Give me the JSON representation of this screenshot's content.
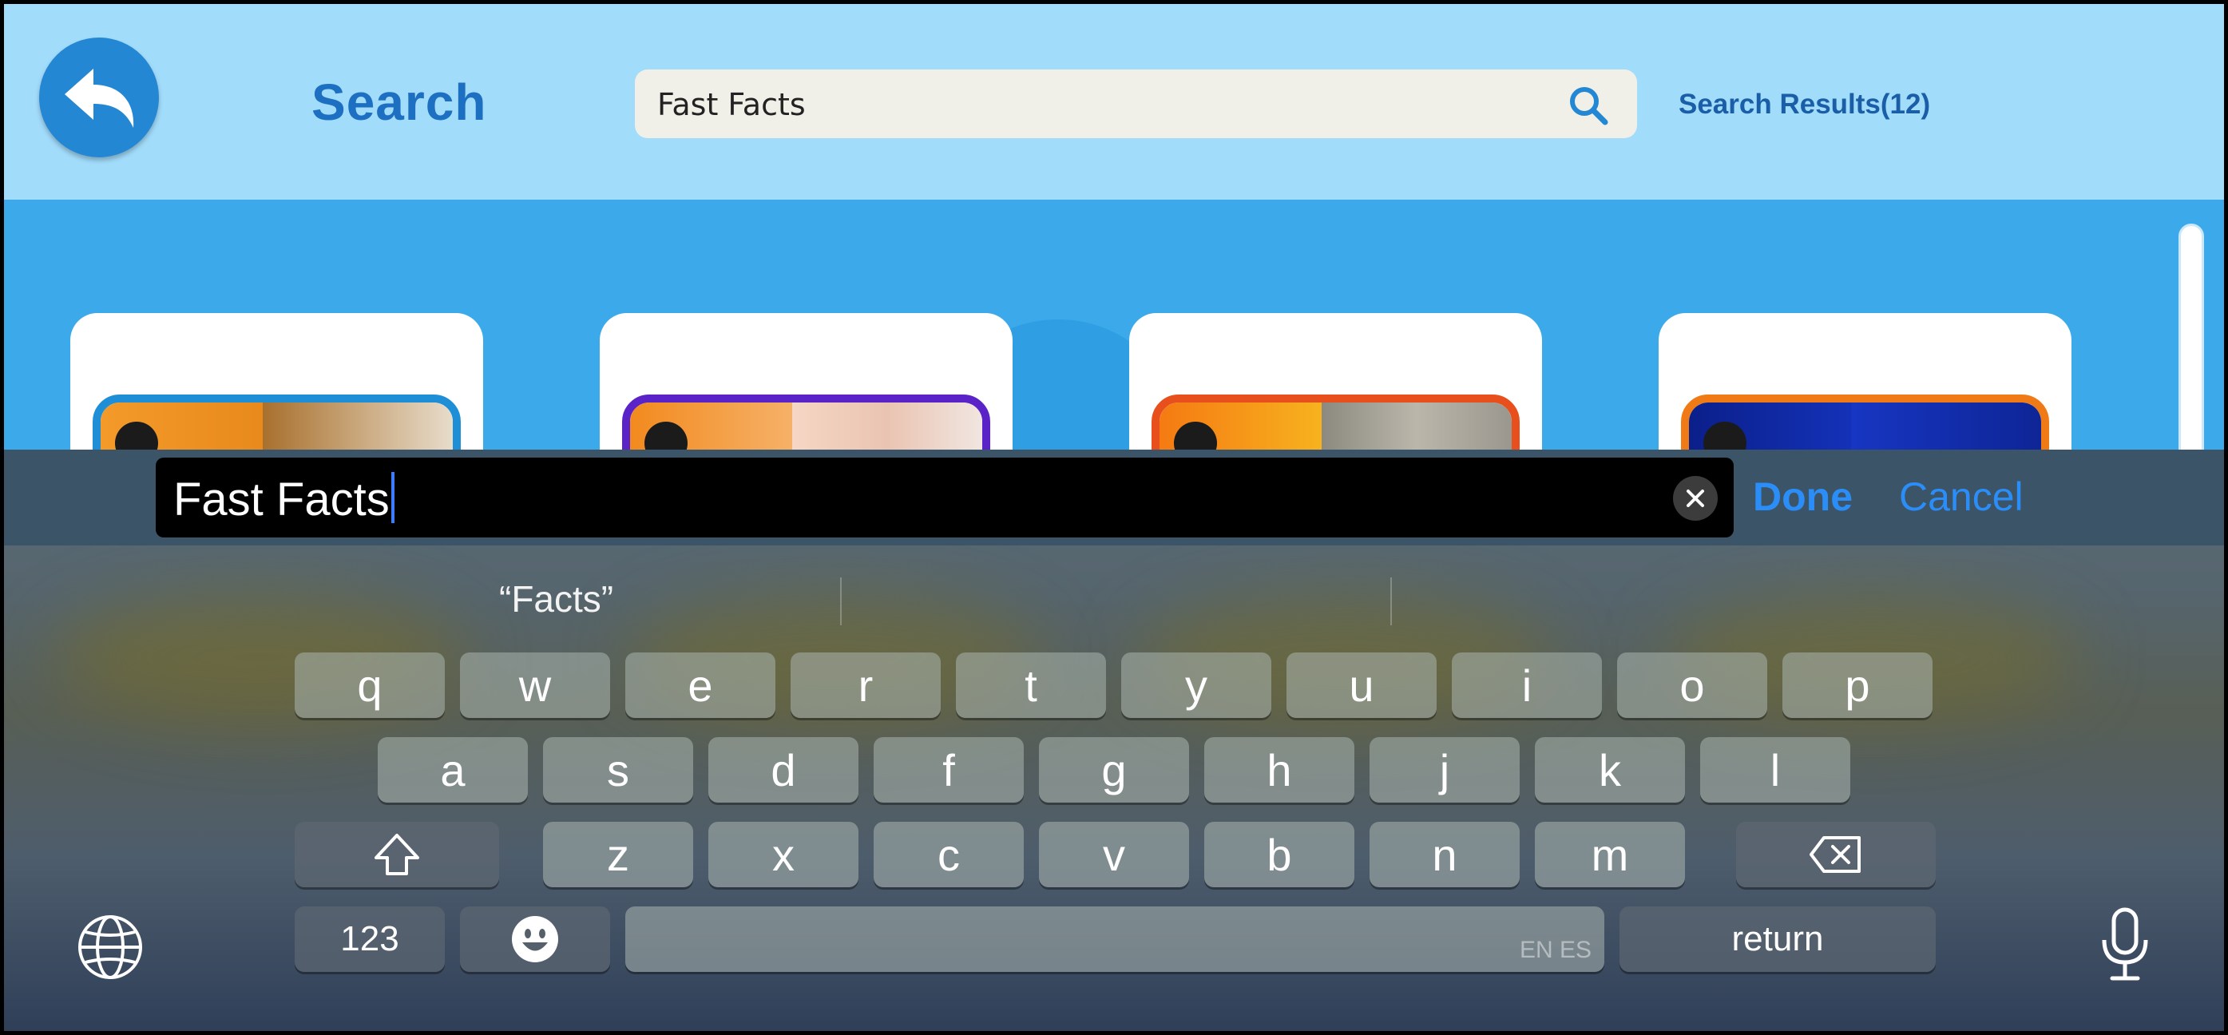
{
  "header": {
    "title": "Search",
    "search_value": "Fast Facts",
    "results_label": "Search Results(12)"
  },
  "keyboard": {
    "input_value": "Fast Facts",
    "done_label": "Done",
    "cancel_label": "Cancel",
    "suggestions": [
      "“Facts”",
      "",
      ""
    ],
    "row1": [
      "q",
      "w",
      "e",
      "r",
      "t",
      "y",
      "u",
      "i",
      "o",
      "p"
    ],
    "row2": [
      "a",
      "s",
      "d",
      "f",
      "g",
      "h",
      "j",
      "k",
      "l"
    ],
    "row3": [
      "z",
      "x",
      "c",
      "v",
      "b",
      "n",
      "m"
    ],
    "numbers_label": "123",
    "return_label": "return",
    "space_languages": "EN ES"
  },
  "colors": {
    "header_bg": "#a2dcfb",
    "content_bg": "#3ba9ea",
    "accent_blue": "#2b8ef8",
    "title_blue": "#1d6fc1"
  },
  "icons": [
    "back-arrow-icon",
    "search-icon",
    "clear-icon",
    "shift-icon",
    "delete-icon",
    "emoji-icon",
    "globe-icon",
    "microphone-icon"
  ]
}
